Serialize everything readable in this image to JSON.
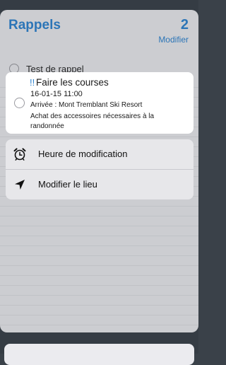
{
  "list": {
    "title": "Rappels",
    "count": "2",
    "edit_label": "Modifier"
  },
  "reminders": [
    {
      "label": "Test de rappel"
    }
  ],
  "detail": {
    "priority": "!!",
    "title": "Faire les courses",
    "date": "16-01-15 11:00",
    "location": "Arrivée  : Mont Tremblant Ski Resort",
    "notes": "Achat des accessoires nécessaires à la randonnée"
  },
  "menu": {
    "items": [
      {
        "label": "Heure de modification",
        "icon": "alarm-clock-icon"
      },
      {
        "label": "Modifier le lieu",
        "icon": "location-arrow-icon"
      }
    ]
  },
  "colors": {
    "accent": "#2f84d0",
    "background": "#3a4149"
  }
}
